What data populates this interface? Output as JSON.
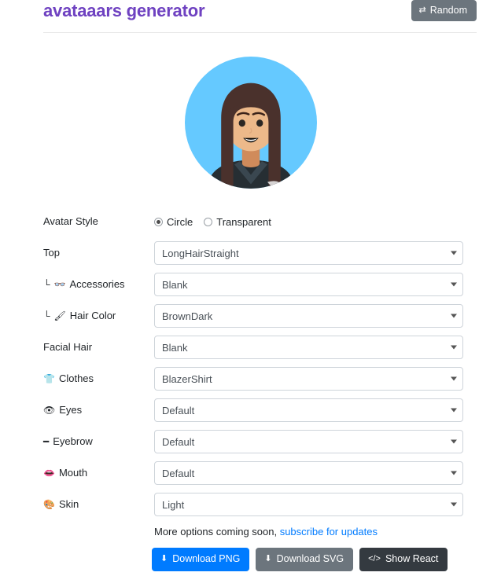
{
  "header": {
    "title": "avataaars generator",
    "random_button": {
      "label": "Random",
      "icon": "shuffle-icon"
    }
  },
  "avatar": {
    "alt": "generated avatar preview",
    "background_color": "#65C9FF",
    "hair_color": "#4A312C",
    "skin_color": "#EDB98A",
    "clothes_color": "#262E33"
  },
  "form": {
    "rows": [
      {
        "label": "Avatar Style",
        "icon": "",
        "type": "radio",
        "options": [
          {
            "label": "Circle",
            "selected": true
          },
          {
            "label": "Transparent",
            "selected": false
          }
        ]
      },
      {
        "label": "Top",
        "icon": "",
        "type": "select",
        "value": "LongHairStraight"
      },
      {
        "label": "Accessories",
        "icon": "glasses-icon",
        "prefix": "└",
        "type": "select",
        "value": "Blank"
      },
      {
        "label": "Hair Color",
        "icon": "paint-roller-icon",
        "prefix": "└",
        "type": "select",
        "value": "BrownDark"
      },
      {
        "label": "Facial Hair",
        "icon": "",
        "type": "select",
        "value": "Blank"
      },
      {
        "label": "Clothes",
        "icon": "tshirt-icon",
        "type": "select",
        "value": "BlazerShirt"
      },
      {
        "label": "Eyes",
        "icon": "eye-square-icon",
        "type": "select",
        "value": "Default"
      },
      {
        "label": "Eyebrow",
        "icon": "eyebrow-icon",
        "type": "select",
        "value": "Default"
      },
      {
        "label": "Mouth",
        "icon": "mouth-icon",
        "type": "select",
        "value": "Default"
      },
      {
        "label": "Skin",
        "icon": "palette-icon",
        "type": "select",
        "value": "Light"
      }
    ]
  },
  "footer": {
    "note_text": "More options coming soon, ",
    "note_link": "subscribe for updates",
    "buttons": [
      {
        "label": "Download PNG",
        "icon": "download-icon",
        "style": "primary"
      },
      {
        "label": "Download SVG",
        "icon": "download-icon",
        "style": "secondary"
      },
      {
        "label": "Show React",
        "icon": "code-icon",
        "style": "dark"
      }
    ]
  },
  "colors": {
    "brand": "#6f42c1",
    "primary": "#007bff",
    "secondary": "#6c757d",
    "dark": "#343a40",
    "link": "#007bff"
  }
}
